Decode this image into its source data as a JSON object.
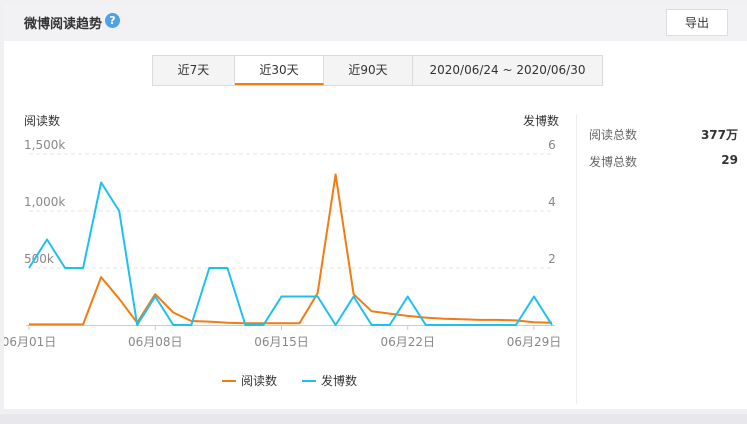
{
  "header": {
    "title": "微博阅读趋势",
    "help_icon": "?",
    "export_label": "导出"
  },
  "tabs": [
    {
      "label": "近7天",
      "active": false
    },
    {
      "label": "近30天",
      "active": true
    },
    {
      "label": "近90天",
      "active": false
    },
    {
      "label": "2020/06/24 ~ 2020/06/30",
      "active": false
    }
  ],
  "stats": [
    {
      "label": "阅读总数",
      "value": "377万"
    },
    {
      "label": "发博总数",
      "value": "29"
    }
  ],
  "chart_data": {
    "type": "line",
    "left_axis_title": "阅读数",
    "right_axis_title": "发博数",
    "x_tick_labels": [
      "06月01日",
      "06月08日",
      "06月15日",
      "06月22日",
      "06月29日"
    ],
    "x_tick_index": [
      0,
      7,
      14,
      21,
      28
    ],
    "left_ticks": [
      {
        "value": 0,
        "label": ""
      },
      {
        "value": 500000,
        "label": "500k"
      },
      {
        "value": 1000000,
        "label": "1,000k"
      },
      {
        "value": 1500000,
        "label": "1,500k"
      }
    ],
    "right_ticks": [
      {
        "value": 0,
        "label": ""
      },
      {
        "value": 2,
        "label": "2"
      },
      {
        "value": 4,
        "label": "4"
      },
      {
        "value": 6,
        "label": "6"
      }
    ],
    "ylim_left": [
      0,
      1500000
    ],
    "ylim_right": [
      0,
      6
    ],
    "colors": {
      "reads": "#f07c12",
      "posts": "#1ec0f0",
      "grid": "#e6e6e6",
      "axis": "#ccc",
      "text": "#888"
    },
    "series": [
      {
        "name": "阅读数",
        "axis": "left",
        "values": [
          5000,
          5000,
          5000,
          5000,
          420000,
          230000,
          20000,
          270000,
          110000,
          35000,
          30000,
          20000,
          15000,
          15000,
          15000,
          15000,
          280000,
          1320000,
          270000,
          120000,
          100000,
          80000,
          65000,
          55000,
          50000,
          45000,
          45000,
          40000,
          25000,
          20000
        ]
      },
      {
        "name": "发博数",
        "axis": "right",
        "values": [
          2,
          3,
          2,
          2,
          5,
          4,
          0,
          1,
          0,
          0,
          2,
          2,
          0,
          0,
          1,
          1,
          1,
          0,
          1,
          0,
          0,
          1,
          0,
          0,
          0,
          0,
          0,
          0,
          1,
          0
        ]
      }
    ],
    "legend_position": "bottom-center"
  }
}
